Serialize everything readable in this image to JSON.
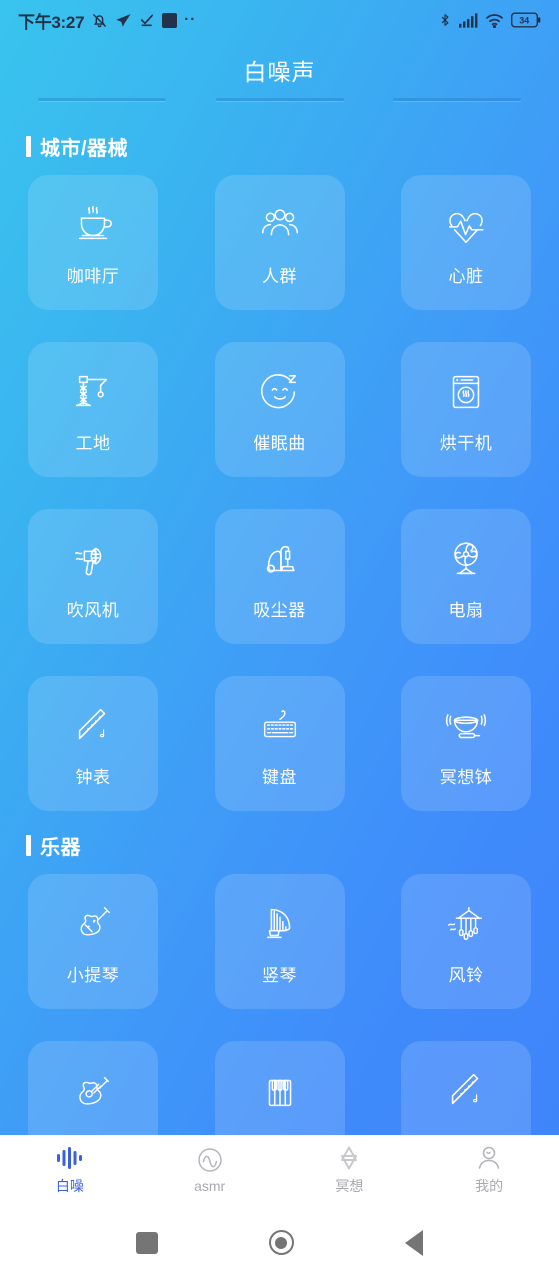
{
  "status_bar": {
    "time": "下午3:27",
    "left_icons": [
      "bell-muted-icon",
      "send-arrow-icon",
      "check-mark-icon",
      "square-icon",
      "more-dots-icon"
    ],
    "right_icons": [
      "bluetooth-icon",
      "signal-bars-icon",
      "wifi-icon",
      "battery-icon"
    ],
    "battery_level": "34"
  },
  "header": {
    "title": "白噪声"
  },
  "sections": [
    {
      "title": "城市/器械",
      "items": [
        {
          "label": "咖啡厅",
          "icon": "coffee-cup-icon"
        },
        {
          "label": "人群",
          "icon": "people-group-icon"
        },
        {
          "label": "心脏",
          "icon": "heart-pulse-icon"
        },
        {
          "label": "工地",
          "icon": "crane-icon"
        },
        {
          "label": "催眠曲",
          "icon": "sleeping-face-icon"
        },
        {
          "label": "烘干机",
          "icon": "dryer-machine-icon"
        },
        {
          "label": "吹风机",
          "icon": "hair-dryer-icon"
        },
        {
          "label": "吸尘器",
          "icon": "vacuum-cleaner-icon"
        },
        {
          "label": "电扇",
          "icon": "electric-fan-icon"
        },
        {
          "label": "钟表",
          "icon": "flute-clock-icon"
        },
        {
          "label": "键盘",
          "icon": "keyboard-icon"
        },
        {
          "label": "冥想钵",
          "icon": "singing-bowl-icon"
        }
      ]
    },
    {
      "title": "乐器",
      "items": [
        {
          "label": "小提琴",
          "icon": "violin-icon"
        },
        {
          "label": "竖琴",
          "icon": "harp-icon"
        },
        {
          "label": "风铃",
          "icon": "wind-chime-icon"
        },
        {
          "label": "",
          "icon": "guitar-icon"
        },
        {
          "label": "",
          "icon": "piano-keys-icon"
        },
        {
          "label": "",
          "icon": "flute-icon"
        }
      ]
    }
  ],
  "tabs": [
    {
      "label": "白噪",
      "icon": "waveform-icon",
      "active": true
    },
    {
      "label": "asmr",
      "icon": "sine-wave-circle-icon",
      "active": false
    },
    {
      "label": "冥想",
      "icon": "lotus-star-icon",
      "active": false
    },
    {
      "label": "我的",
      "icon": "user-profile-icon",
      "active": false
    }
  ],
  "android_nav": {
    "recents": "recents-square-icon",
    "home": "home-circle-icon",
    "back": "back-triangle-icon"
  },
  "colors": {
    "gradient_start": "#39c4ee",
    "gradient_end": "#3f83fa",
    "card_fill": "rgba(255,255,255,0.14)",
    "active_tab": "#3a5fe0",
    "inactive_tab": "#a9aab0"
  }
}
